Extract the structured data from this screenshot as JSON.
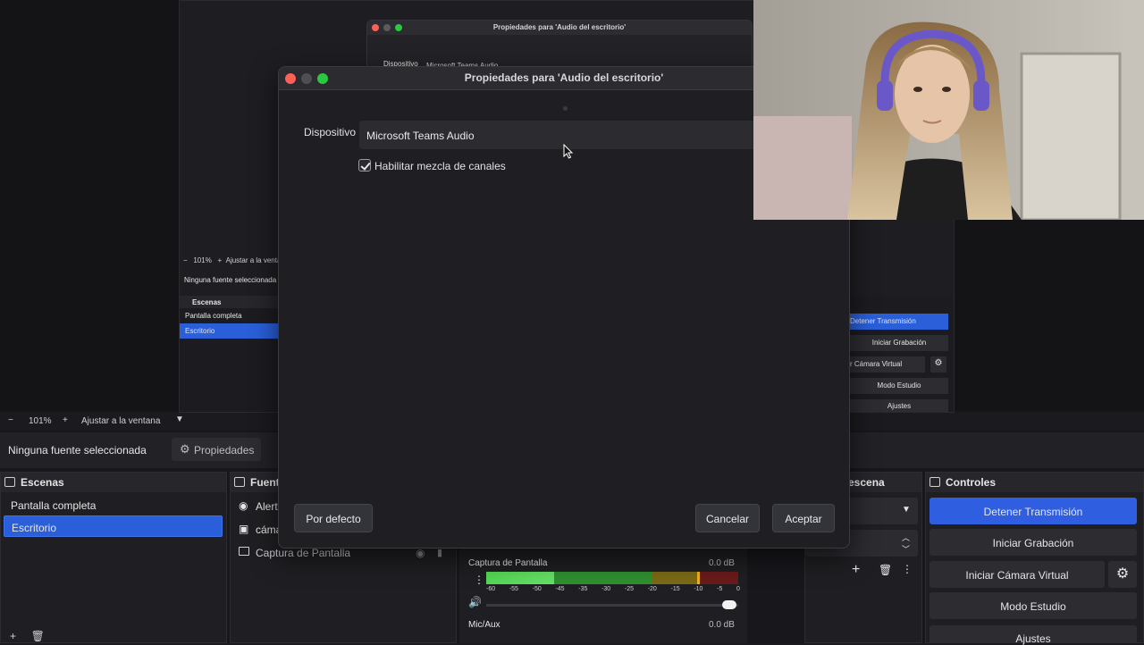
{
  "back_dialog": {
    "title": "Propiedades para 'Audio del escritorio'",
    "device_label": "Dispositivo",
    "device_value": "Microsoft Teams Audio"
  },
  "inner_preview": {
    "zoom": "101%",
    "fit": "Ajustar a la ventana",
    "no_source": "Ninguna fuente seleccionada",
    "scenes_title": "Escenas",
    "scenes": [
      "Pantalla completa",
      "Escritorio"
    ],
    "controls": [
      "Detener Transmisión",
      "Iniciar Grabación",
      "r Cámara Virtual",
      "Modo Estudio",
      "Ajustes"
    ]
  },
  "zoom_bar": {
    "minus": "−",
    "zoom": "101%",
    "plus": "+",
    "fit": "Ajustar a la ventana"
  },
  "source_bar": {
    "no_source": "Ninguna fuente seleccionada",
    "properties": "Propiedades"
  },
  "scenes": {
    "title": "Escenas",
    "items": [
      {
        "label": "Pantalla completa",
        "selected": false
      },
      {
        "label": "Escritorio",
        "selected": true
      }
    ]
  },
  "sources": {
    "title": "Fuente",
    "items": [
      "Alerta",
      "cáma",
      "Captura de Pantalla"
    ]
  },
  "transition_panel": {
    "title": "escena"
  },
  "mixer": {
    "tracks": [
      {
        "name": "Captura de Pantalla",
        "level": "0.0 dB"
      },
      {
        "name": "Mic/Aux",
        "level": "0.0 dB"
      }
    ],
    "scale": [
      "-60",
      "-55",
      "-50",
      "-45",
      "-35",
      "-30",
      "-25",
      "-20",
      "-15",
      "-10",
      "-5",
      "0"
    ]
  },
  "controls": {
    "title": "Controles",
    "stop_stream": "Detener Transmisión",
    "start_record": "Iniciar Grabación",
    "virtual_cam": "Iniciar Cámara Virtual",
    "studio_mode": "Modo Estudio",
    "settings": "Ajustes"
  },
  "dialog": {
    "title": "Propiedades para 'Audio del escritorio'",
    "device_label": "Dispositivo",
    "device_value": "Microsoft Teams Audio",
    "channel_mix_label": "Habilitar mezcla de canales",
    "channel_mix_checked": true,
    "defaults_button": "Por defecto",
    "cancel_button": "Cancelar",
    "ok_button": "Aceptar"
  },
  "colors": {
    "accent": "#2f5fe0",
    "close": "#fe5f57",
    "minimize": "#febc2e",
    "zoom": "#28c840"
  }
}
